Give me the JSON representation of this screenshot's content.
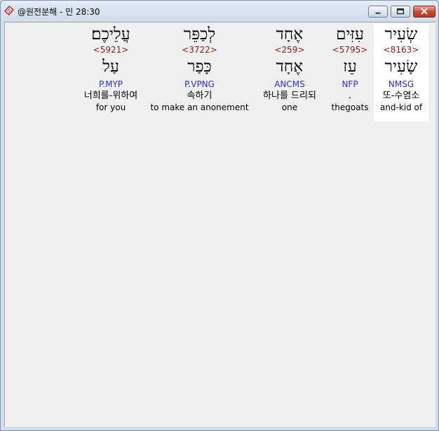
{
  "window": {
    "title": "@원전분해 - 민 28:30",
    "controls": {
      "minimize": "minimize-icon",
      "maximize": "maximize-icon",
      "close": "close-icon"
    }
  },
  "words": [
    {
      "hebrew": "שְׂעִיר",
      "strong": "<8163>",
      "root": "שָׂעִיר",
      "parse": "NMSG",
      "korean": "또-수염소",
      "english": "and-kid of"
    },
    {
      "hebrew": "עִזִּים",
      "strong": "<5795>",
      "root": "עֵז",
      "parse": "NFP",
      "korean": ".",
      "english": "thegoats"
    },
    {
      "hebrew": "אֶחָד",
      "strong": "<259>",
      "root": "אֶחָד",
      "parse": "ANCMS",
      "korean": "하나를 드리되",
      "english": "one"
    },
    {
      "hebrew": "לְכַפֵּר",
      "strong": "<3722>",
      "root": "כָּפַר",
      "parse": "P.VPNG",
      "korean": "속하기",
      "english": "to make an anonement"
    },
    {
      "hebrew": "עֲלֵיכֶם׃",
      "strong": "<5921>",
      "root": "עַל",
      "parse": "P.MYP",
      "korean": "너희를-위하여",
      "english": "for you"
    }
  ]
}
